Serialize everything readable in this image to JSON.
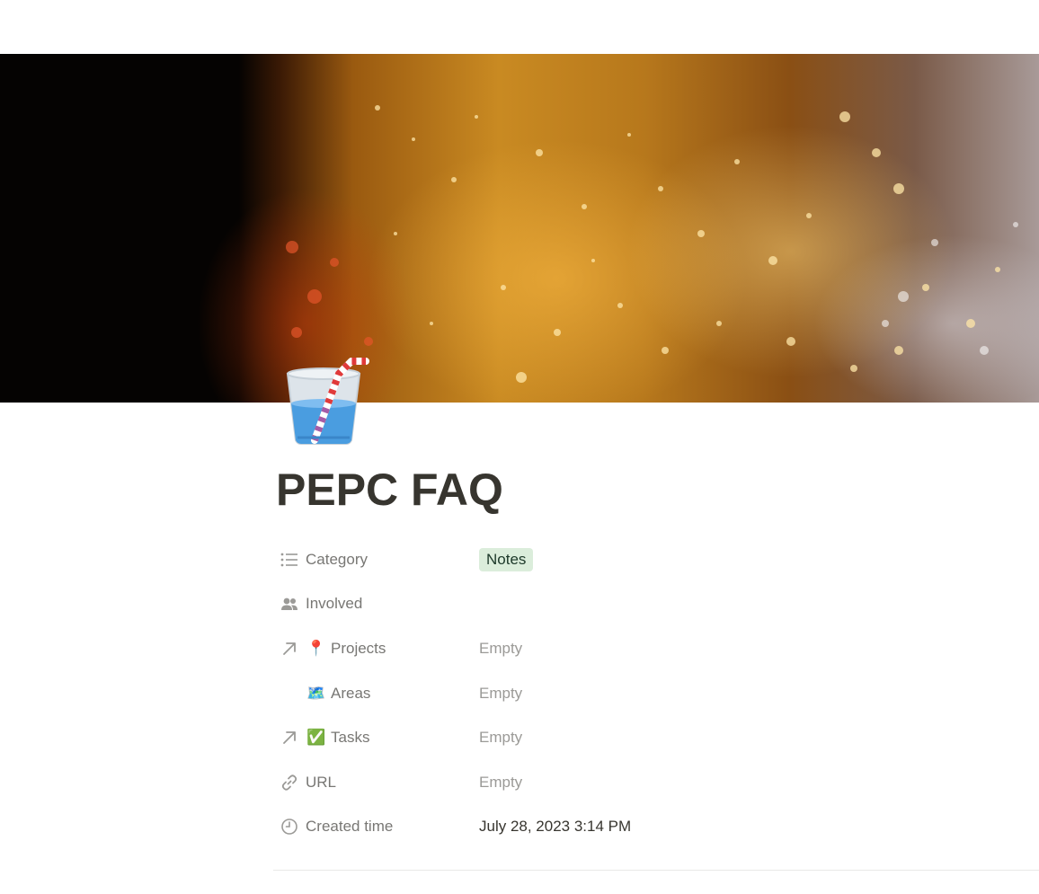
{
  "page": {
    "title": "PEPC FAQ",
    "icon": "cup-with-straw-icon"
  },
  "properties": [
    {
      "icon": "list-icon",
      "label": "Category",
      "value": "Notes",
      "value_type": "tag",
      "tag_color": "#dbeddb"
    },
    {
      "icon": "people-icon",
      "label": "Involved",
      "value": "",
      "value_type": "blank"
    },
    {
      "icon": "arrow-up-right-icon",
      "emoji": "📍",
      "label": "Projects",
      "value": "Empty",
      "value_type": "empty"
    },
    {
      "icon": "",
      "emoji": "🗺️",
      "label": "Areas",
      "value": "Empty",
      "value_type": "empty"
    },
    {
      "icon": "arrow-up-right-icon",
      "emoji": "✅",
      "label": "Tasks",
      "value": "Empty",
      "value_type": "empty"
    },
    {
      "icon": "link-icon",
      "label": "URL",
      "value": "Empty",
      "value_type": "empty"
    },
    {
      "icon": "clock-icon",
      "label": "Created time",
      "value": "July 28, 2023 3:14 PM",
      "value_type": "datetime"
    }
  ]
}
